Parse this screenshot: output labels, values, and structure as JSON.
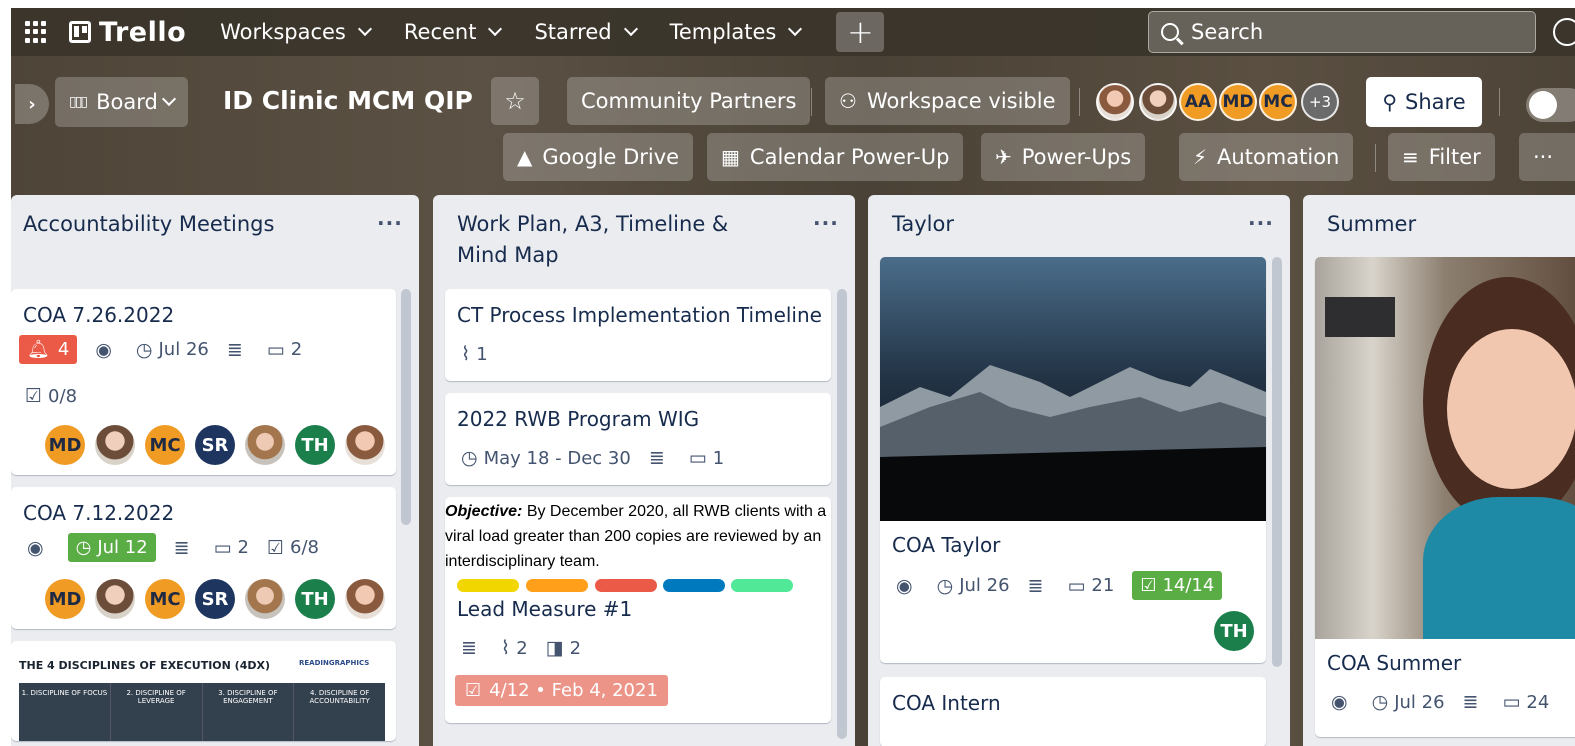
{
  "header": {
    "brand": "Trello",
    "menus": [
      "Workspaces",
      "Recent",
      "Starred",
      "Templates"
    ],
    "plus": "+",
    "search_placeholder": "Search"
  },
  "board": {
    "view": "Board",
    "title": "ID Clinic MCM QIP",
    "workspace": "Community Partners",
    "visibility": "Workspace visible",
    "members": [
      "AA",
      "MD",
      "MC"
    ],
    "more_members": "+3",
    "share": "Share",
    "powerups": [
      "Google Drive",
      "Calendar Power-Up",
      "Power-Ups",
      "Automation"
    ],
    "filter": "Filter"
  },
  "colors": {
    "label_red": "#eb5a46",
    "label_green": "#5aac44",
    "avatar_orange": "#ef9b24",
    "avatar_navy": "#1e3560",
    "avatar_green": "#1a7f4b"
  },
  "lists": [
    {
      "title": "Accountability Meetings",
      "cards": [
        {
          "title": "COA 7.26.2022",
          "notifications": "4",
          "due": "Jul 26",
          "comments": "2",
          "checklist": "0/8",
          "members": [
            "MD",
            "MC",
            "SR",
            "TH"
          ]
        },
        {
          "title": "COA 7.12.2022",
          "due": "Jul 12",
          "comments": "2",
          "checklist": "6/8",
          "members": [
            "MD",
            "MC",
            "SR",
            "TH"
          ]
        },
        {
          "cover_title": "THE 4 DISCIPLINES OF EXECUTION (4DX)",
          "cover_brand": "READINGRAPHICS",
          "cover_columns": [
            "1. DISCIPLINE OF FOCUS",
            "2. DISCIPLINE OF LEVERAGE",
            "3. DISCIPLINE OF ENGAGEMENT",
            "4. DISCIPLINE OF ACCOUNTABILITY"
          ]
        }
      ]
    },
    {
      "title": "Work Plan, A3, Timeline & Mind Map",
      "cards": [
        {
          "title": "CT Process Implementation Timeline",
          "attachments": "1"
        },
        {
          "title": "2022 RWB Program WIG",
          "due": "May 18 - Dec 30",
          "comments": "1"
        },
        {
          "objective_label": "Objective:",
          "objective_text": "By December 2020, all RWB clients with a viral load greater than 200 copies are reviewed by an interdisciplinary team.",
          "title": "Lead Measure #1",
          "attachments": "2",
          "boards": "2",
          "checklist_due": "4/12 • Feb 4, 2021",
          "labels": [
            "#f2d600",
            "#ff9f1a",
            "#eb5a46",
            "#0079bf",
            "#51e898"
          ]
        }
      ]
    },
    {
      "title": "Taylor",
      "cards": [
        {
          "title": "COA Taylor",
          "due": "Jul 26",
          "comments": "21",
          "checklist": "14/14",
          "members": [
            "TH"
          ]
        },
        {
          "title": "COA Intern"
        }
      ]
    },
    {
      "title": "Summer",
      "cards": [
        {
          "title": "COA Summer",
          "due": "Jul 26",
          "comments": "24"
        }
      ]
    }
  ]
}
